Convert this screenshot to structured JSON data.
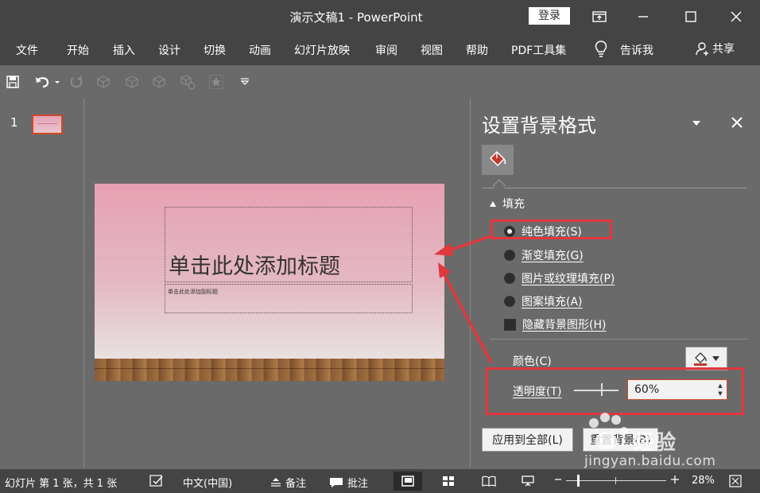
{
  "window": {
    "title": "演示文稿1  -  PowerPoint",
    "login_label": "登录"
  },
  "menu": {
    "items": [
      "文件",
      "开始",
      "插入",
      "设计",
      "切换",
      "动画",
      "幻灯片放映",
      "审阅",
      "视图",
      "帮助",
      "PDF工具集"
    ],
    "tell_me": "告诉我",
    "share": "共享"
  },
  "thumbnails": {
    "slide_number": "1"
  },
  "slide": {
    "title_placeholder": "单击此处添加标题",
    "subtitle_placeholder": "单击此处添加副标题"
  },
  "panel": {
    "title": "设置背景格式",
    "section": "填充",
    "options": [
      {
        "label": "纯色填充(S)",
        "selected": true
      },
      {
        "label": "渐变填充(G)",
        "selected": false
      },
      {
        "label": "图片或纹理填充(P)",
        "selected": false
      },
      {
        "label": "图案填充(A)",
        "selected": false
      }
    ],
    "hide_graphics_label": "隐藏背景图形(H)",
    "color_label": "颜色(C)",
    "transparency_label": "透明度(T)",
    "transparency_value": "60%",
    "apply_all_label": "应用到全部(L)",
    "reset_label": "重置背景(B)"
  },
  "status": {
    "slide_info": "幻灯片 第 1 张，共 1 张",
    "language": "中文(中国)",
    "notes": "备注",
    "comments": "批注",
    "zoom": "28%",
    "zoom_level_fraction": 0.28
  },
  "watermark": {
    "brand": "经验",
    "url": "jingyan.baidu.com"
  },
  "colors": {
    "chrome": "#444444",
    "workspace": "#6a6a6a",
    "accent": "#d24726",
    "annotation": "#e2383d"
  }
}
